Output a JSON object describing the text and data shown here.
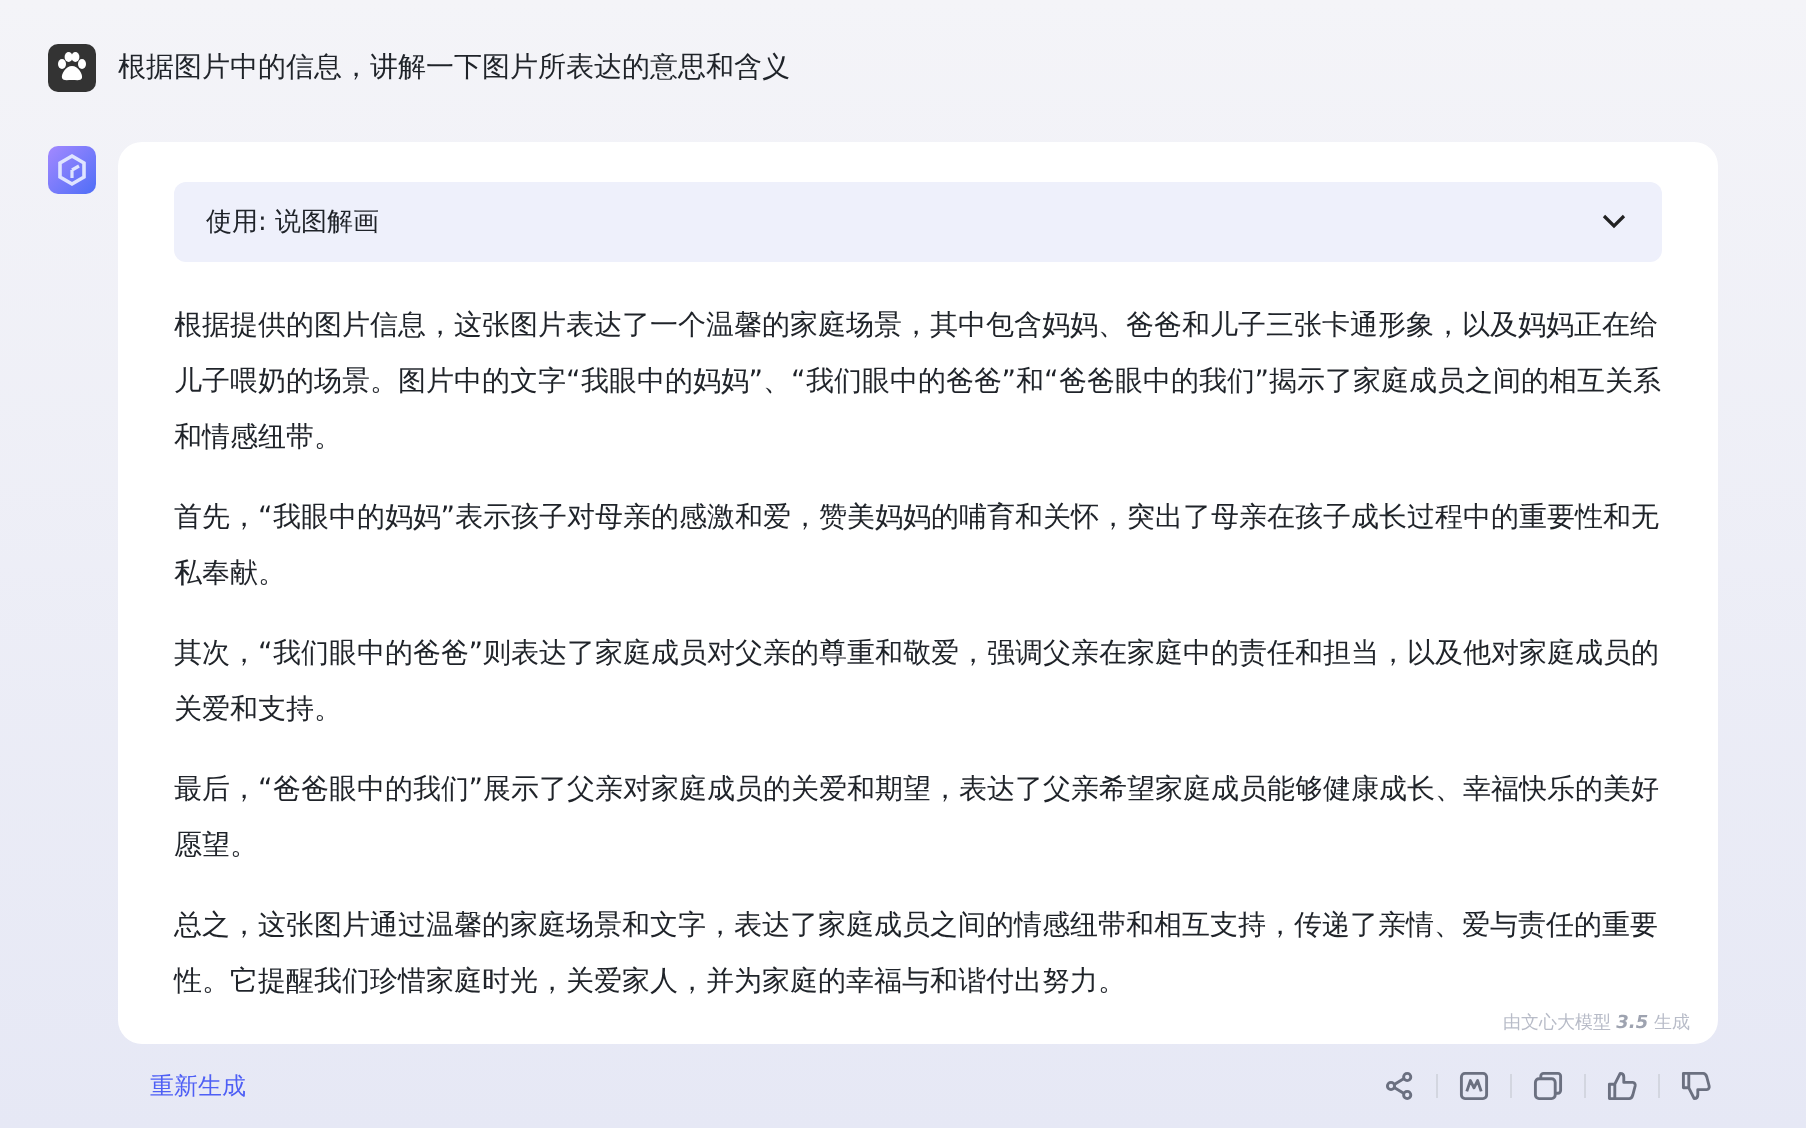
{
  "question": {
    "text": "根据图片中的信息，讲解一下图片所表达的意思和含义"
  },
  "answer": {
    "tool": {
      "label": "使用: 说图解画",
      "expanded": false
    },
    "paragraphs": [
      "根据提供的图片信息，这张图片表达了一个温馨的家庭场景，其中包含妈妈、爸爸和儿子三张卡通形象，以及妈妈正在给儿子喂奶的场景。图片中的文字“我眼中的妈妈”、“我们眼中的爸爸”和“爸爸眼中的我们”揭示了家庭成员之间的相互关系和情感纽带。",
      "首先，“我眼中的妈妈”表示孩子对母亲的感激和爱，赞美妈妈的哺育和关怀，突出了母亲在孩子成长过程中的重要性和无私奉献。",
      "其次，“我们眼中的爸爸”则表达了家庭成员对父亲的尊重和敬爱，强调父亲在家庭中的责任和担当，以及他对家庭成员的关爱和支持。",
      "最后，“爸爸眼中的我们”展示了父亲对家庭成员的关爱和期望，表达了父亲希望家庭成员能够健康成长、幸福快乐的美好愿望。",
      "总之，这张图片通过温馨的家庭场景和文字，表达了家庭成员之间的情感纽带和相互支持，传递了亲情、爱与责任的重要性。它提醒我们珍惜家庭时光，关爱家人，并为家庭的幸福与和谐付出努力。"
    ],
    "source_note": "由文心大模型 **3.5** 生成"
  },
  "actions": {
    "regenerate": "重新生成"
  }
}
